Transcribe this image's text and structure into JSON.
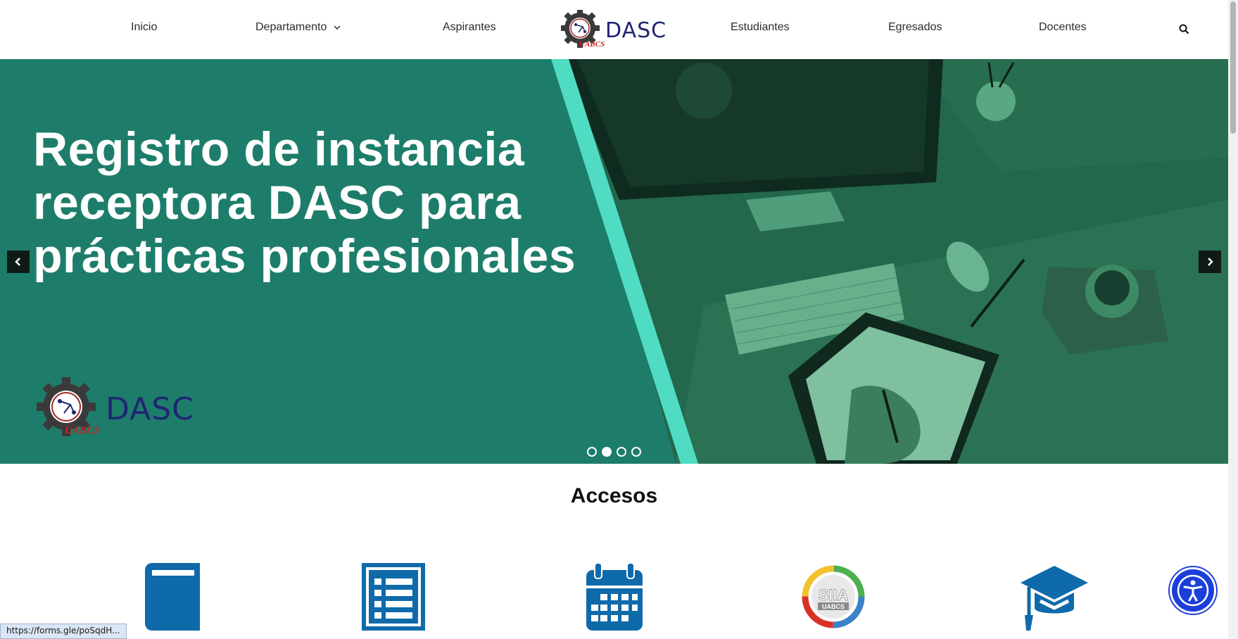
{
  "nav": {
    "items": [
      {
        "label": "Inicio"
      },
      {
        "label": "Departamento"
      },
      {
        "label": "Aspirantes"
      },
      {
        "label": "Estudiantes"
      },
      {
        "label": "Egresados"
      },
      {
        "label": "Docentes"
      }
    ],
    "logo_text": "DASC",
    "search_icon": "search-icon"
  },
  "hero": {
    "title": "Registro de instancia receptora DASC para prácticas profesionales",
    "logo_text": "DASC",
    "slides_total": 4,
    "active_slide": 2
  },
  "accesos": {
    "title": "Accesos",
    "items": [
      {
        "icon": "book-icon"
      },
      {
        "icon": "list-icon"
      },
      {
        "icon": "calendar-icon"
      },
      {
        "icon": "siia-logo",
        "label": "SIIA UABCS"
      },
      {
        "icon": "graduation-cap-icon"
      }
    ]
  },
  "status_bar": {
    "url": "https://forms.gle/poSqdH..."
  },
  "colors": {
    "hero_green": "#1d7d6a",
    "accent_stripe": "#4fdcc3",
    "icon_blue": "#0f6aaa",
    "a11y_blue": "#1b3fd8",
    "logo_navy": "#1f2672"
  }
}
